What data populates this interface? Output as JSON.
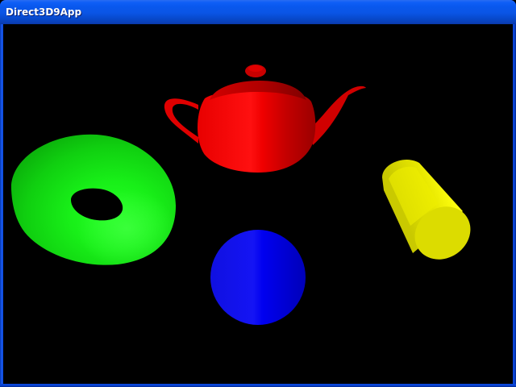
{
  "window": {
    "title": "Direct3D9App"
  },
  "scene": {
    "background": "#000000",
    "objects": [
      {
        "name": "teapot",
        "color": "#ff0000"
      },
      {
        "name": "torus",
        "color": "#00ff00"
      },
      {
        "name": "cylinder",
        "color": "#ffff00"
      },
      {
        "name": "sphere",
        "color": "#0000ff"
      }
    ]
  }
}
